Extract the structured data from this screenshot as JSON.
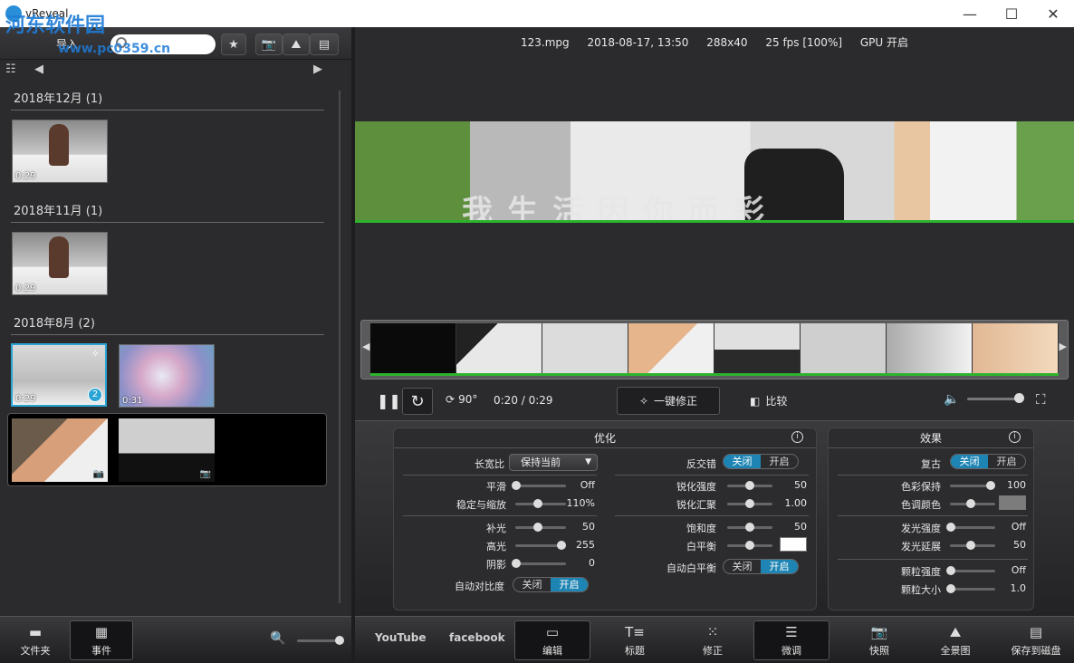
{
  "window": {
    "title": "vReveal",
    "min": "—",
    "max": "☐",
    "close": "✕"
  },
  "watermark": {
    "text": "河东软件园",
    "url": "www.pc0359.cn"
  },
  "left_toolbar": {
    "import_label": "导入",
    "search_placeholder": ""
  },
  "groups": [
    {
      "title": "2018年12月 (1)",
      "items": [
        {
          "duration": "0:29"
        }
      ]
    },
    {
      "title": "2018年11月 (1)",
      "items": [
        {
          "duration": "0:29"
        }
      ]
    },
    {
      "title": "2018年8月 (2)",
      "items": [
        {
          "duration": "0:29",
          "badge": "2"
        },
        {
          "duration": "0:31"
        }
      ]
    }
  ],
  "file_info": {
    "name": "123.mpg",
    "datetime": "2018-08-17, 13:50",
    "resolution": "288x40",
    "fps": "25 fps [100%]",
    "gpu": "GPU 开启"
  },
  "video": {
    "subtitle": "我生活因你而彩"
  },
  "controls": {
    "rotate_label": "90°",
    "time": "0:20 / 0:29",
    "one_click_fix": "一键修正",
    "compare": "比较"
  },
  "optimize": {
    "title": "优化",
    "aspect_label": "长宽比",
    "aspect_value": "保持当前",
    "deinterlace_label": "反交错",
    "smooth_label": "平滑",
    "smooth_value": "Off",
    "stabilize_label": "稳定与缩放",
    "stabilize_value": "110%",
    "fill_light_label": "补光",
    "fill_light_value": "50",
    "highlight_label": "高光",
    "highlight_value": "255",
    "shadow_label": "阴影",
    "shadow_value": "0",
    "auto_contrast_label": "自动对比度",
    "sharpen_label": "锐化强度",
    "sharpen_value": "50",
    "sharpen_focus_label": "锐化汇聚",
    "sharpen_focus_value": "1.00",
    "saturation_label": "饱和度",
    "saturation_value": "50",
    "white_balance_label": "白平衡",
    "auto_wb_label": "自动白平衡",
    "toggle_off": "关闭",
    "toggle_on": "开启"
  },
  "effects": {
    "title": "效果",
    "vintage_label": "复古",
    "color_keep_label": "色彩保持",
    "color_keep_value": "100",
    "tint_label": "色调颜色",
    "glow_strength_label": "发光强度",
    "glow_strength_value": "Off",
    "glow_spread_label": "发光延展",
    "glow_spread_value": "50",
    "grain_strength_label": "颗粒强度",
    "grain_strength_value": "Off",
    "grain_size_label": "颗粒大小",
    "grain_size_value": "1.0",
    "toggle_off": "关闭",
    "toggle_on": "开启"
  },
  "bottom_left": {
    "folder": "文件夹",
    "events": "事件"
  },
  "bottom_right": {
    "youtube": "YouTube",
    "facebook": "facebook",
    "edit": "编辑",
    "title": "标题",
    "fix": "修正",
    "finetune": "微调",
    "snapshot": "快照",
    "panorama": "全景图",
    "save": "保存到磁盘"
  },
  "colors": {
    "accent": "#1e84b3",
    "selected_border": "#2aa4d4",
    "progress": "#2db32d"
  }
}
